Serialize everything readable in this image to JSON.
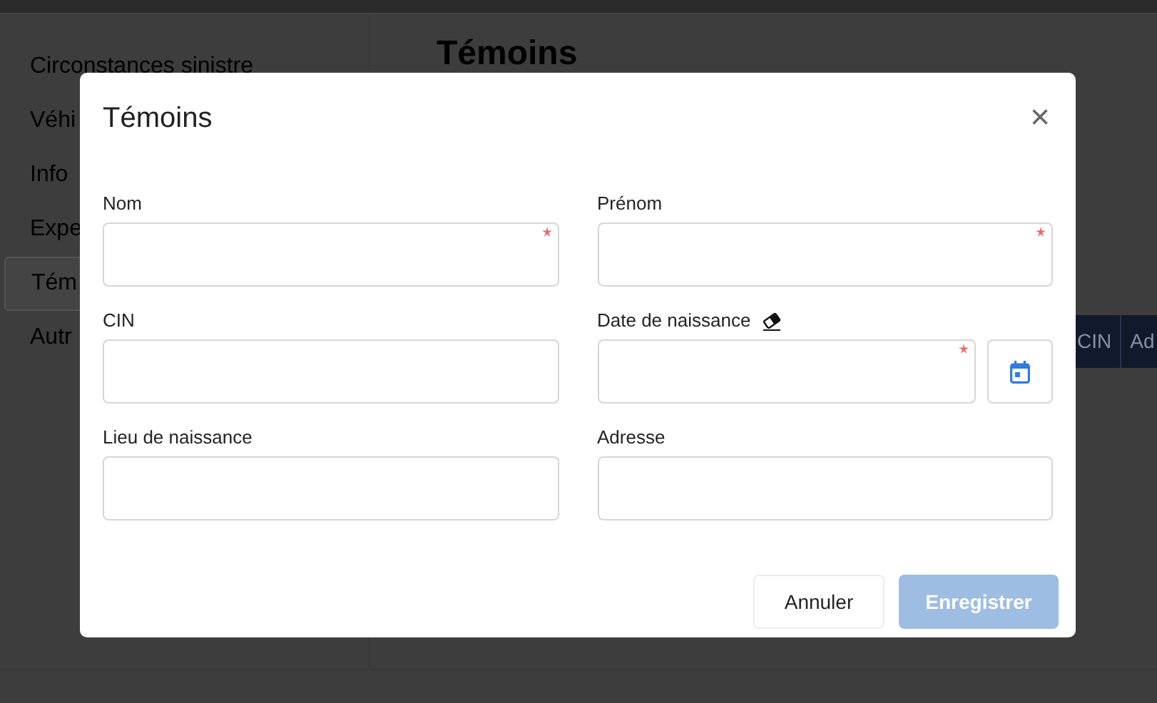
{
  "sidebar": {
    "items": [
      {
        "label": "Circonstances sinistre",
        "selected": false
      },
      {
        "label": "Véhi",
        "selected": false
      },
      {
        "label": "Info",
        "selected": false
      },
      {
        "label": "Expe",
        "selected": false
      },
      {
        "label": "Tém",
        "selected": true
      },
      {
        "label": "Autr",
        "selected": false
      }
    ]
  },
  "main": {
    "heading": "Témoins"
  },
  "table": {
    "columns": [
      "CIN",
      "Ad"
    ]
  },
  "modal": {
    "title": "Témoins",
    "close": "×",
    "fields": [
      {
        "label": "Nom",
        "kind": "text",
        "required": true
      },
      {
        "label": "Prénom",
        "kind": "text",
        "required": true
      },
      {
        "label": "CIN",
        "kind": "text",
        "required": false
      },
      {
        "label": "Date de naissance",
        "kind": "date",
        "required": true
      },
      {
        "label": "Lieu de naissance",
        "kind": "text",
        "required": false
      },
      {
        "label": "Adresse",
        "kind": "text",
        "required": false
      }
    ],
    "buttons": [
      {
        "label": "Annuler",
        "kind": "secondary",
        "disabled": false
      },
      {
        "label": "Enregistrer",
        "kind": "primary",
        "disabled": true
      }
    ]
  }
}
